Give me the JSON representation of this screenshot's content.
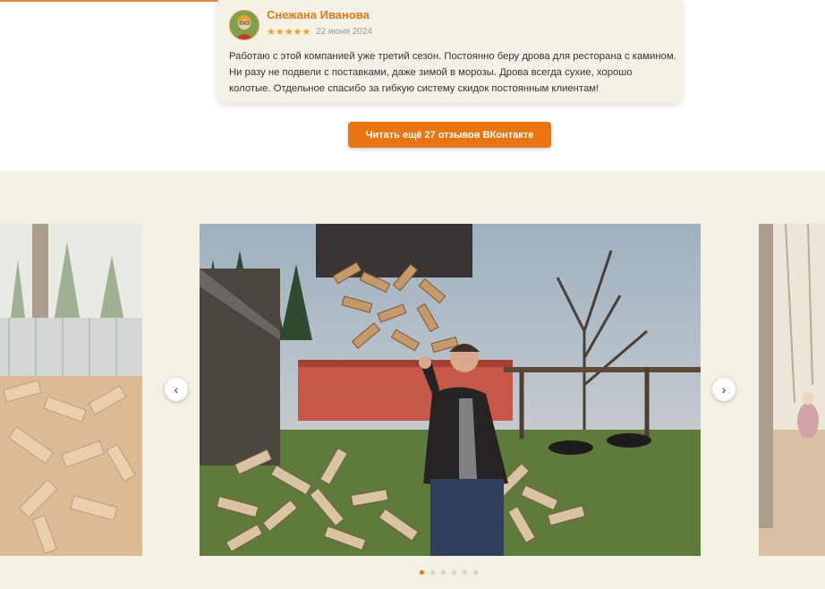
{
  "review": {
    "name": "Снежана Иванова",
    "stars": "★★★★★",
    "rating": 5,
    "date": "22 июня 2024",
    "text": "Работаю с этой компанией уже третий сезон. Постоянно беру дрова для ресторана с камином. Ни разу не подвели с поставками, даже зимой в морозы. Дрова всегда сухие, хорошо колотые. Отдельное спасибо за гибкую систему скидок постоянным клиентам!"
  },
  "more_button": {
    "label": "Читать ещё 27 отзывов ВКонтакте"
  },
  "gallery": {
    "prev_icon": "chevron-left-icon",
    "next_icon": "chevron-right-icon",
    "prev_glyph": "‹",
    "next_glyph": "›",
    "slide_count": 6,
    "active_slide": 1
  },
  "colors": {
    "accent": "#e8750f",
    "name": "#e07a1b",
    "star": "#f1a11e",
    "card_bg": "#f6f1e6",
    "section_bg": "#f5f0e4"
  }
}
